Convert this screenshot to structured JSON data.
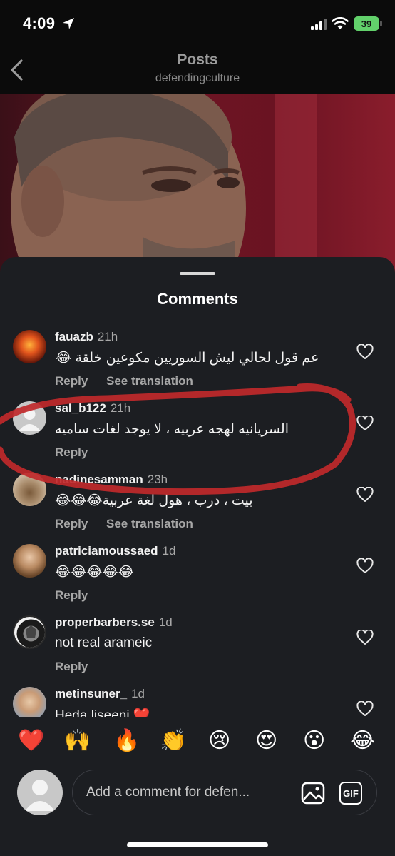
{
  "status_bar": {
    "time": "4:09",
    "battery": "39"
  },
  "header": {
    "title": "Posts",
    "subtitle": "defendingculture"
  },
  "sheet": {
    "title": "Comments"
  },
  "comments": [
    {
      "username": "fauazb",
      "time": "21h",
      "text": "عم قول لحالي ليش السوريين مكوعين خلقة 😂",
      "reply": "Reply",
      "translate": "See translation"
    },
    {
      "username": "sal_b122",
      "time": "21h",
      "text": "السريانيه لهجه عربيه ، لا يوجد لغات ساميه",
      "reply": "Reply"
    },
    {
      "username": "nadinesamman",
      "time": "23h",
      "text": "بيت ، درب ، هول لغة عربية😂😂😂",
      "reply": "Reply",
      "translate": "See translation"
    },
    {
      "username": "patriciamoussaed",
      "time": "1d",
      "text": "😂😂😂😂😂",
      "reply": "Reply"
    },
    {
      "username": "properbarbers.se",
      "time": "1d",
      "text": "not real arameic",
      "reply": "Reply"
    },
    {
      "username": "metinsuner_",
      "time": "1d",
      "text": "Heda liseeni ❤️"
    }
  ],
  "emoji_bar": [
    "❤️",
    "🙌",
    "🔥",
    "👏",
    "😢",
    "😍",
    "😮",
    "😂"
  ],
  "composer": {
    "placeholder": "Add a comment for defen...",
    "gif_label": "GIF"
  }
}
